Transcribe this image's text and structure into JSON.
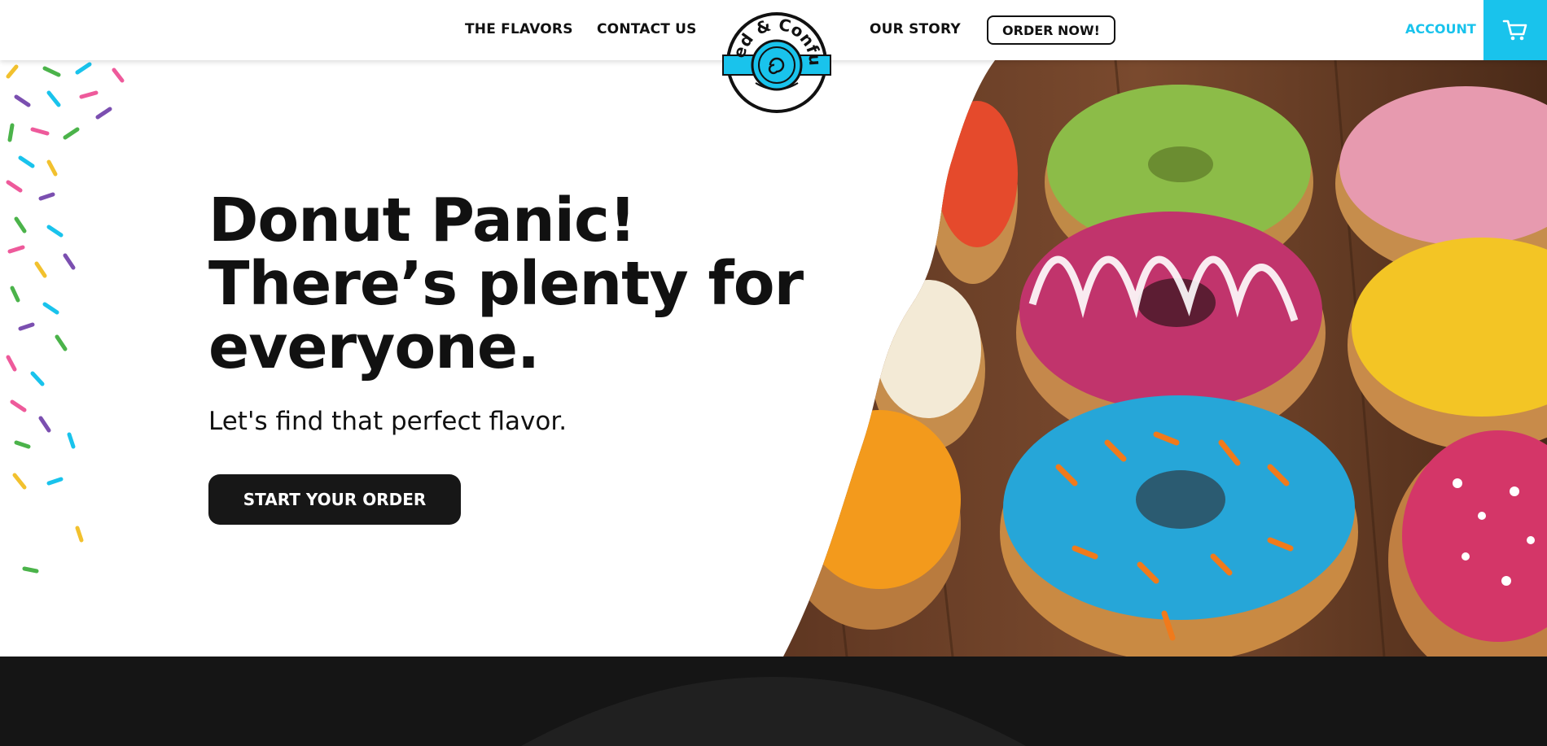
{
  "header": {
    "nav": {
      "flavors": "THE FLAVORS",
      "contact": "CONTACT US",
      "story": "OUR STORY"
    },
    "order_button": "ORDER NOW!",
    "account": "ACCOUNT",
    "cart_icon": "cart-icon",
    "logo_text": "Glazed & Confused"
  },
  "hero": {
    "headline_1": "Donut Panic!",
    "headline_2": "There’s plenty for",
    "headline_3": "everyone.",
    "subtitle": "Let's find that perfect flavor.",
    "cta": "START YOUR ORDER"
  },
  "colors": {
    "accent": "#19c3ec",
    "dark": "#151515",
    "button": "#171717"
  }
}
